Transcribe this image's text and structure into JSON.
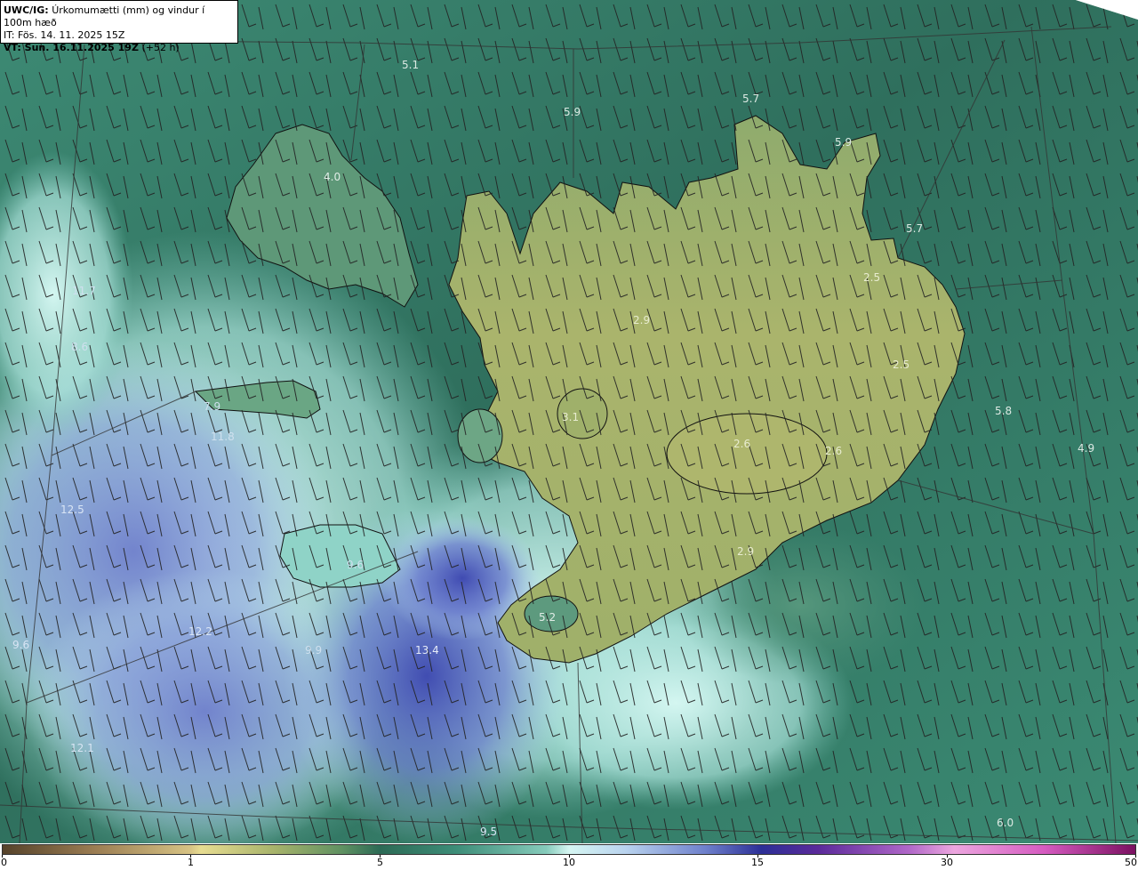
{
  "header": {
    "product_label": "UWC/IG:",
    "product_desc": "Úrkomumætti (mm) og vindur í 100m hæð",
    "init_time": "IT: Fös. 14. 11. 2025 15Z",
    "valid_label": "VT: Sun. 16.11.2025 19Z",
    "lead_time": "(+52 h)"
  },
  "colorbar": {
    "ticks": [
      "0",
      "1",
      "5",
      "10",
      "15",
      "30",
      "50"
    ]
  },
  "map_values": [
    "5.1",
    "5.9",
    "5.7",
    "5.9",
    "4.0",
    "5.7",
    "2.5",
    "2.9",
    "2.5",
    "5.8",
    "4.9",
    "3.1",
    "2.6",
    "2.6",
    "2.9",
    "5.2",
    "13.4",
    "9.9",
    "12.2",
    "12.5",
    "11.8",
    "8.6",
    "11.7",
    "12.1",
    "6.0",
    "7.9",
    "9.6",
    "9.6",
    "9.5"
  ],
  "colors": {
    "ocean_dark": "#2f6e5c",
    "ocean_mid": "#3e8b76",
    "land_highland": "#a9b36c",
    "heavy_precip": "#6b7fcc",
    "moist_cyan": "#b9ece6"
  }
}
